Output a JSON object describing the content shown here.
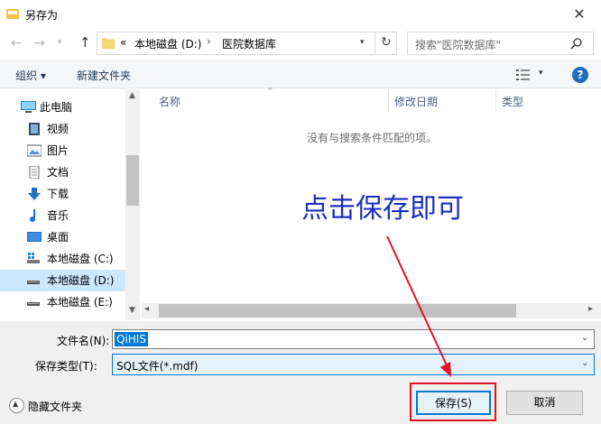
{
  "window": {
    "title": "另存为",
    "close_glyph": "✕"
  },
  "nav": {
    "back_glyph": "←",
    "forward_glyph": "→",
    "up_glyph": "↑",
    "breadcrumb": [
      "«",
      "本地磁盘 (D:)",
      "›",
      "医院数据库"
    ],
    "refresh_glyph": "↻",
    "search_placeholder": "搜索\"医院数据库\""
  },
  "toolbar": {
    "organize": "组织 ▾",
    "new_folder": "新建文件夹"
  },
  "sidebar": {
    "items": [
      {
        "label": "此电脑",
        "icon": "computer-icon"
      },
      {
        "label": "视频",
        "icon": "video-icon"
      },
      {
        "label": "图片",
        "icon": "picture-icon"
      },
      {
        "label": "文档",
        "icon": "document-icon"
      },
      {
        "label": "下载",
        "icon": "download-icon"
      },
      {
        "label": "音乐",
        "icon": "music-icon"
      },
      {
        "label": "桌面",
        "icon": "desktop-icon"
      },
      {
        "label": "本地磁盘 (C:)",
        "icon": "drive-icon"
      },
      {
        "label": "本地磁盘 (D:)",
        "icon": "drive-icon"
      },
      {
        "label": "本地磁盘 (E:)",
        "icon": "drive-icon"
      }
    ]
  },
  "columns": {
    "name": "名称",
    "modified": "修改日期",
    "type": "类型"
  },
  "empty_message": "没有与搜索条件匹配的项。",
  "form": {
    "filename_label": "文件名(N):",
    "filename_value": "QiHIS",
    "filetype_label": "保存类型(T):",
    "filetype_value": "SQL文件(*.mdf)"
  },
  "footer": {
    "hide_folders": "隐藏文件夹",
    "save": "保存(S)",
    "cancel": "取消"
  },
  "annotation": {
    "text": "点击保存即可"
  },
  "colors": {
    "accent": "#0078d7",
    "annotation_text": "#1d2fbe",
    "highlight": "#e81123"
  }
}
